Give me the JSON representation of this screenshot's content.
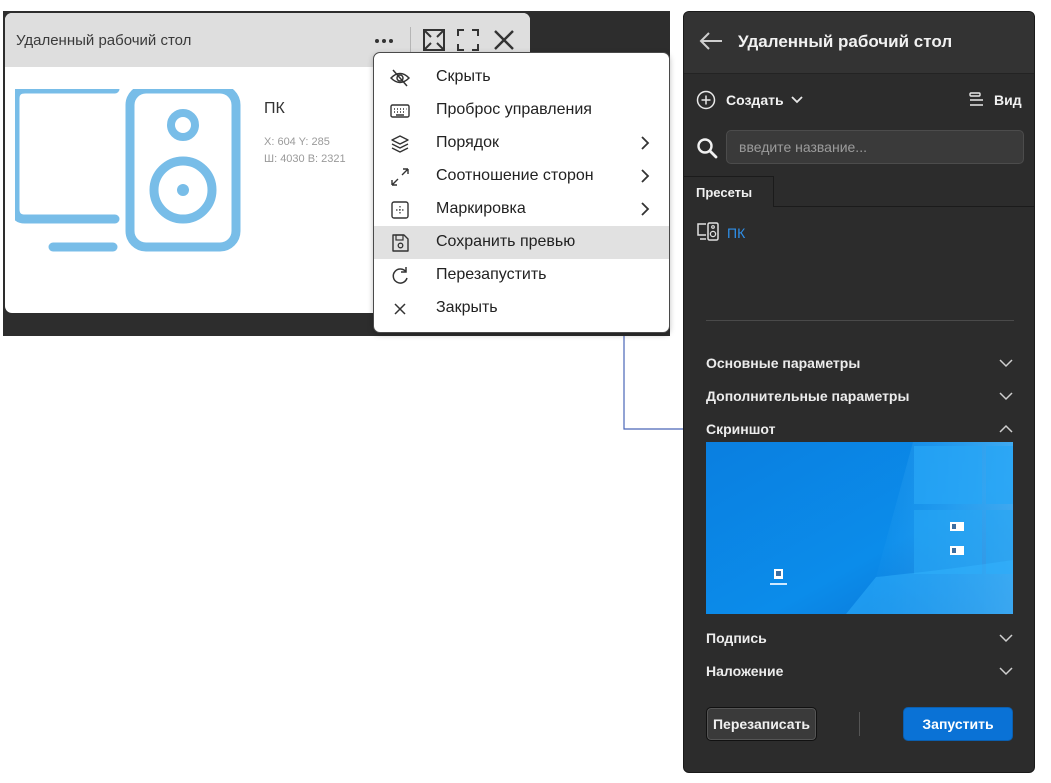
{
  "widget": {
    "title": "Удаленный рабочий стол",
    "device_name": "ПК",
    "coords": "X: 604 Y: 285",
    "size": "Ш: 4030 В: 2321",
    "icon_color": "#78bde8"
  },
  "context_menu": {
    "items": [
      {
        "label": "Скрыть",
        "icon": "eye-slash-icon"
      },
      {
        "label": "Проброс управления",
        "icon": "keyboard-icon"
      },
      {
        "label": "Порядок",
        "icon": "layers-icon",
        "submenu": true
      },
      {
        "label": "Соотношение сторон",
        "icon": "resize-arrows-icon",
        "submenu": true
      },
      {
        "label": "Маркировка",
        "icon": "marker-icon",
        "submenu": true
      },
      {
        "label": "Сохранить превью",
        "icon": "floppy-disk-icon",
        "highlighted": true
      },
      {
        "label": "Перезапустить",
        "icon": "refresh-icon"
      },
      {
        "label": "Закрыть",
        "icon": "close-icon"
      }
    ]
  },
  "panel": {
    "title": "Удаленный рабочий стол",
    "create_label": "Создать",
    "view_label": "Вид",
    "search_placeholder": "введите название...",
    "tab_presets": "Пресеты",
    "preset_item": "ПК",
    "sections": {
      "basic": "Основные параметры",
      "advanced": "Дополнительные параметры",
      "screenshot": "Скриншот",
      "caption": "Подпись",
      "overlay": "Наложение"
    },
    "btn_rewrite": "Перезаписать",
    "btn_run": "Запустить",
    "accent_color": "#0a72d6",
    "link_color": "#2f8fe8"
  }
}
